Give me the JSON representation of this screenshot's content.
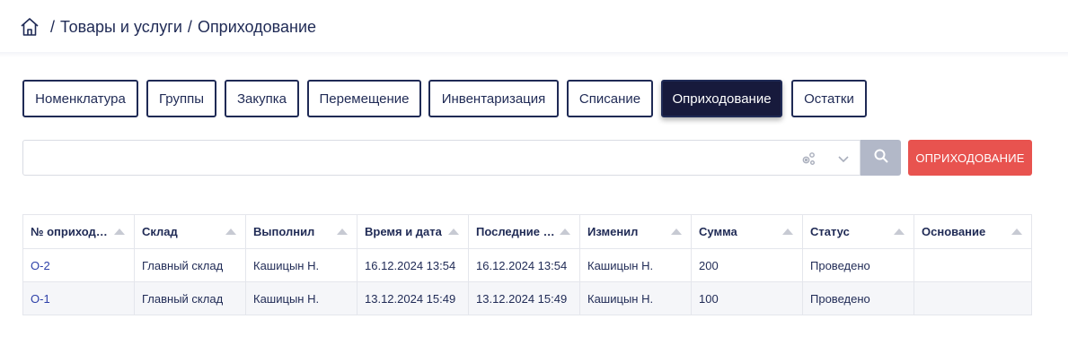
{
  "breadcrumb": {
    "items": [
      "Товары и услуги",
      "Оприходование"
    ],
    "separator": "/"
  },
  "tabs": [
    {
      "label": "Номенклатура",
      "active": false
    },
    {
      "label": "Группы",
      "active": false
    },
    {
      "label": "Закупка",
      "active": false
    },
    {
      "label": "Перемещение",
      "active": false
    },
    {
      "label": "Инвентаризация",
      "active": false
    },
    {
      "label": "Списание",
      "active": false
    },
    {
      "label": "Оприходование",
      "active": true
    },
    {
      "label": "Остатки",
      "active": false
    }
  ],
  "search": {
    "value": "",
    "placeholder": ""
  },
  "toolbar": {
    "primary_label": "ОПРИХОДОВАНИЕ"
  },
  "table": {
    "columns": [
      "№ оприход…",
      "Склад",
      "Выполнил",
      "Время и дата",
      "Последние …",
      "Изменил",
      "Сумма",
      "Статус",
      "Основание"
    ],
    "rows": [
      [
        "О-2",
        "Главный склад",
        "Кашицын Н.",
        "16.12.2024 13:54",
        "16.12.2024 13:54",
        "Кашицын Н.",
        "200",
        "Проведено",
        ""
      ],
      [
        "О-1",
        "Главный склад",
        "Кашицын Н.",
        "13.12.2024 15:49",
        "13.12.2024 15:49",
        "Кашицын Н.",
        "100",
        "Проведено",
        ""
      ]
    ]
  },
  "colors": {
    "text": "#1f2a55",
    "active_tab": "#171a3c",
    "primary_button": "#e8534f",
    "search_button": "#b2b8c8",
    "link": "#2c3fa8"
  },
  "icons": {
    "home": "home-icon",
    "settings": "gears-icon",
    "chevron": "chevron-down-icon",
    "search": "search-icon"
  }
}
